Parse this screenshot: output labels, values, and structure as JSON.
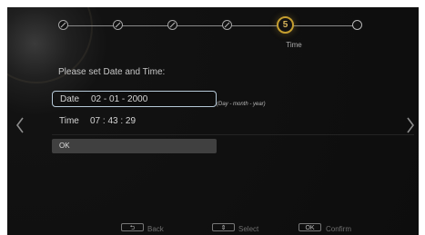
{
  "setup": {
    "steps": [
      {
        "state": "done",
        "icon": "check-icon"
      },
      {
        "state": "done",
        "icon": "check-icon"
      },
      {
        "state": "done",
        "icon": "check-icon"
      },
      {
        "state": "done",
        "icon": "check-icon"
      },
      {
        "state": "active",
        "number": "5"
      },
      {
        "state": "pending"
      }
    ],
    "active_step_label": "Time"
  },
  "form": {
    "prompt": "Please set Date and Time:",
    "date_label": "Date",
    "date_value": "02 - 01 - 2000",
    "date_hint": "(Day - month - year)",
    "time_label": "Time",
    "time_value": "07 : 43 : 29",
    "ok_label": "OK"
  },
  "footer": {
    "back_key": "⮌",
    "back_label": "Back",
    "select_key": "⇕",
    "select_label": "Select",
    "confirm_key": "OK",
    "confirm_label": "Confirm"
  },
  "colors": {
    "background": "#0d0d0d",
    "active_step": "#c59e2f",
    "focus_border": "#b6c9d8",
    "button": "#404040"
  }
}
